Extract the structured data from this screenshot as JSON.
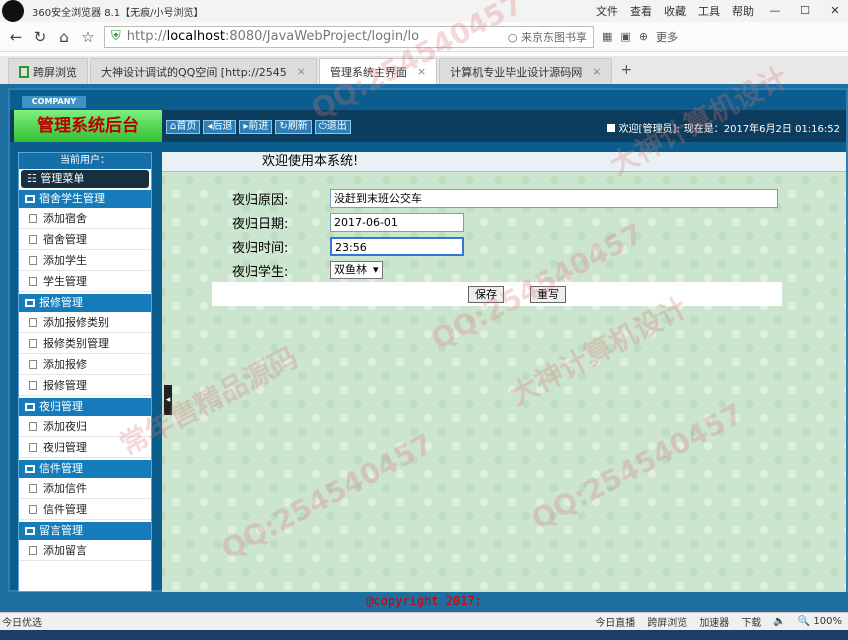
{
  "browser": {
    "title": "360安全浏览器 8.1【无痕/小号浏览】",
    "menus": [
      "文件",
      "查看",
      "收藏",
      "工具",
      "帮助"
    ],
    "address": {
      "protocol": "http://",
      "host": "localhost",
      "rest": ":8080/JavaWebProject/login/lo",
      "search_placeholder": "来京东图书享"
    },
    "more": "更多",
    "tabs": [
      {
        "label": "跨屏浏览"
      },
      {
        "label": "大神设计调试的QQ空间 [http://2545"
      },
      {
        "label": "管理系统主界面",
        "active": true
      },
      {
        "label": "计算机专业毕业设计源码网"
      }
    ]
  },
  "app": {
    "company": "COMPANY",
    "brand": "管理系统后台",
    "toolbar": [
      "首页",
      "后退",
      "前进",
      "刷新",
      "退出"
    ],
    "welcome": "欢迎[管理员]:",
    "now": "现在是：2017年6月2日 01:16:52",
    "sidebar": {
      "current_user": "当前用户：",
      "menu_title": "管理菜单",
      "groups": [
        {
          "title": "宿舍学生管理",
          "items": [
            "添加宿舍",
            "宿舍管理",
            "添加学生",
            "学生管理"
          ]
        },
        {
          "title": "报修管理",
          "items": [
            "添加报修类别",
            "报修类别管理",
            "添加报修",
            "报修管理"
          ]
        },
        {
          "title": "夜归管理",
          "items": [
            "添加夜归",
            "夜归管理"
          ]
        },
        {
          "title": "信件管理",
          "items": [
            "添加信件",
            "信件管理"
          ]
        },
        {
          "title": "留言管理",
          "items": [
            "添加留言"
          ]
        }
      ]
    },
    "main": {
      "header": "欢迎使用本系统!",
      "form": {
        "reason_label": "夜归原因:",
        "reason_value": "没赶到末班公交车",
        "date_label": "夜归日期:",
        "date_value": "2017-06-01",
        "time_label": "夜归时间:",
        "time_value": "23:56",
        "student_label": "夜归学生:",
        "student_value": "双鱼林",
        "save": "保存",
        "reset": "重写"
      }
    },
    "copyright": "@copyright 2017;"
  },
  "statusbar": {
    "left": "今日优选",
    "items": [
      "今日直播",
      "跨屏浏览",
      "加速器",
      "下载"
    ],
    "zoom": "100%"
  },
  "watermarks": [
    "QQ:254540457",
    "大神计算机设计",
    "常年售精品源码"
  ]
}
